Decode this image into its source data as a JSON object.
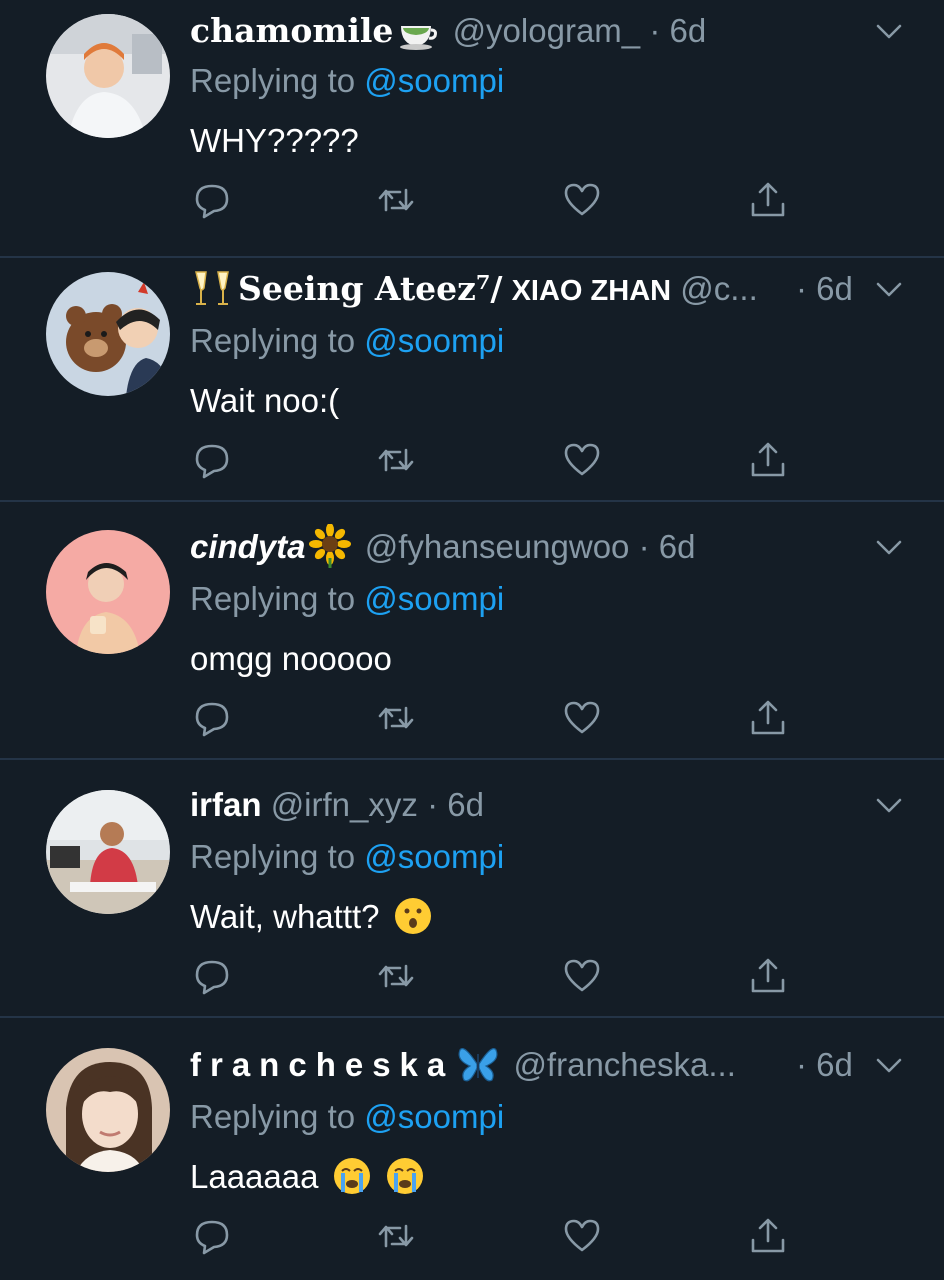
{
  "tweets": [
    {
      "name": "chamomile",
      "name_emoji": "tea-cup-emoji",
      "handle": "@yologram_",
      "time": "· 6d",
      "replying_prefix": "Replying to",
      "mention": "@soompi",
      "text": "WHY?????",
      "avatar_colors": [
        "#d9dde3",
        "#e89b6a"
      ]
    },
    {
      "name_prefix_emoji": "clinking-glasses-emoji",
      "name": "Seeing Ateez⁷/",
      "name_suffix": "XIAO ZHAN",
      "handle": "@c...",
      "time": "· 6d",
      "replying_prefix": "Replying to",
      "mention": "@soompi",
      "text": "Wait noo:(",
      "avatar_colors": [
        "#c7d3e0",
        "#7a4a2a"
      ]
    },
    {
      "name": "cindyta",
      "name_emoji": "sunflower-emoji",
      "handle": "@fyhanseungwoo",
      "time": "· 6d",
      "replying_prefix": "Replying to",
      "mention": "@soompi",
      "text": "omgg nooooo",
      "avatar_colors": [
        "#f5a9a3",
        "#2b2b2b"
      ]
    },
    {
      "name": "irfan",
      "handle": "@irfn_xyz",
      "time": "· 6d",
      "replying_prefix": "Replying to",
      "mention": "@soompi",
      "text": "Wait, whattt?",
      "text_emoji": "surprised-face-emoji",
      "avatar_colors": [
        "#d8dde0",
        "#c9404a"
      ]
    },
    {
      "name": "francheska",
      "name_emoji": "butterfly-emoji",
      "handle": "@francheska...",
      "time": "· 6d",
      "replying_prefix": "Replying to",
      "mention": "@soompi",
      "text": "Laaaaaa",
      "text_emoji": "crying-face-emoji",
      "avatar_colors": [
        "#e9d3c2",
        "#4a3324"
      ]
    }
  ],
  "colors": {
    "background": "#141d26",
    "divider": "#243447",
    "name": "#ffffff",
    "muted": "#8899a6",
    "link": "#1da1f2"
  },
  "icons": {
    "reply": "reply-icon",
    "retweet": "retweet-icon",
    "like": "heart-icon",
    "share": "share-icon",
    "menu": "chevron-down-icon"
  }
}
